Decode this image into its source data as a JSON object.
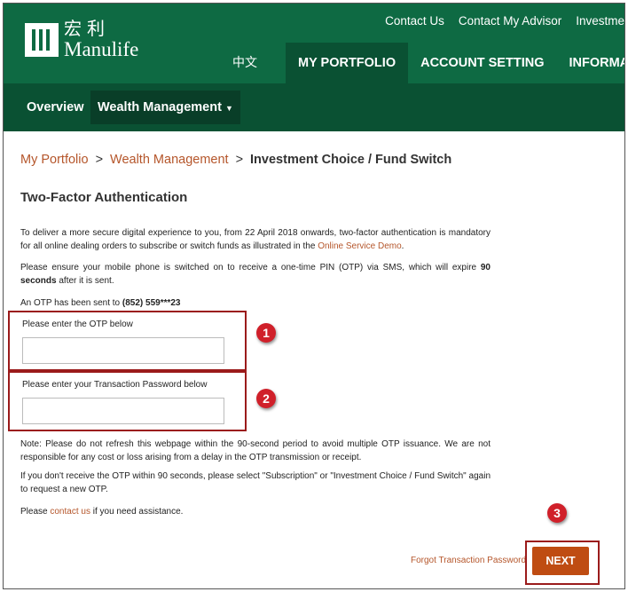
{
  "brand": {
    "logo_cn": "宏利",
    "logo_en": "Manulife",
    "green": "#0e6a43",
    "dark_green": "#0a5133",
    "accent": "#b5562b",
    "button": "#bf4c12",
    "marker": "#d0202a"
  },
  "top_links": [
    "Contact Us",
    "Contact My Advisor",
    "Investme"
  ],
  "lang_switch": "中文",
  "main_nav": [
    "MY PORTFOLIO",
    "ACCOUNT SETTING",
    "INFORMAT"
  ],
  "sub_nav": {
    "overview": "Overview",
    "wealth": "Wealth Management",
    "caret": "▼"
  },
  "breadcrumb": {
    "items": [
      "My Portfolio",
      "Wealth Management"
    ],
    "separator": ">",
    "current": "Investment Choice / Fund Switch"
  },
  "title": "Two-Factor Authentication",
  "paragraphs": {
    "p1_text": "To deliver a more secure digital experience to you, from 22 April 2018 onwards, two-factor authentication is mandatory for all online dealing orders to subscribe or switch funds as illustrated in the ",
    "p1_link": "Online Service Demo",
    "p1_end": ".",
    "p2_text": "Please ensure your mobile phone is switched on to receive a one-time PIN (OTP) via SMS, which will expire ",
    "p2_bold": "90 seconds",
    "p2_end": " after it is sent.",
    "p3_text": "An OTP has been sent to ",
    "p3_bold": "(852) 559***23",
    "p4": "Note: Please do not refresh this webpage within the 90-second period to avoid multiple OTP issuance. We are not responsible for any cost or loss arising from a delay in the OTP transmission or receipt.",
    "p5": "If you don't receive the OTP within 90 seconds, please select \"Subscription\" or \"Investment Choice / Fund Switch\" again to request a new OTP.",
    "p6_start": "Please ",
    "p6_link": "contact us",
    "p6_end": " if you need assistance."
  },
  "otp": {
    "label": "Please enter the OTP below",
    "value": ""
  },
  "password": {
    "label": "Please enter your Transaction Password below",
    "value": ""
  },
  "markers": [
    "1",
    "2",
    "3"
  ],
  "forgot_link": "Forgot Transaction Password",
  "next_label": "NEXT"
}
